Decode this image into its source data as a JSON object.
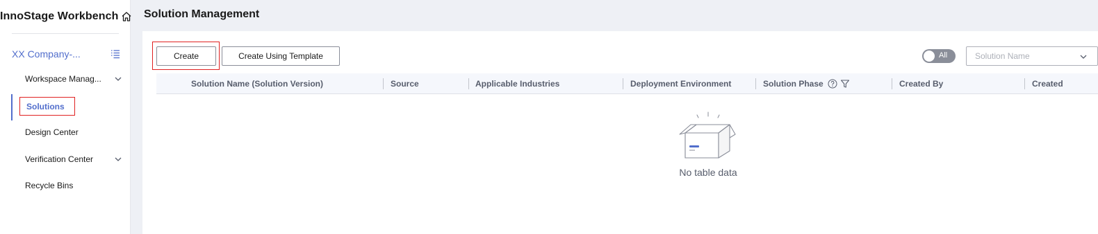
{
  "sidebar": {
    "brand_title": "InnoStage Workbench",
    "company": "XX Company-...",
    "items": [
      {
        "label": "Workspace Manag...",
        "expandable": true
      },
      {
        "label": "Solutions",
        "active": true
      },
      {
        "label": "Design Center"
      },
      {
        "label": "Verification Center",
        "expandable": true
      },
      {
        "label": "Recycle Bins"
      }
    ]
  },
  "header": {
    "title": "Solution Management"
  },
  "toolbar": {
    "create_label": "Create",
    "create_template_label": "Create Using Template",
    "toggle_label": "All",
    "search_placeholder": "Solution Name"
  },
  "table": {
    "columns": [
      "Solution Name (Solution Version)",
      "Source",
      "Applicable Industries",
      "Deployment Environment",
      "Solution Phase",
      "Created By",
      "Created"
    ],
    "empty_text": "No table data"
  },
  "icons": {
    "home": "home-icon",
    "list": "list-icon",
    "chevron": "chevron-down-icon",
    "help": "help-icon",
    "filter": "filter-icon"
  },
  "colors": {
    "accent": "#526ecc",
    "highlight": "#e02020",
    "background": "#eef0f5"
  }
}
